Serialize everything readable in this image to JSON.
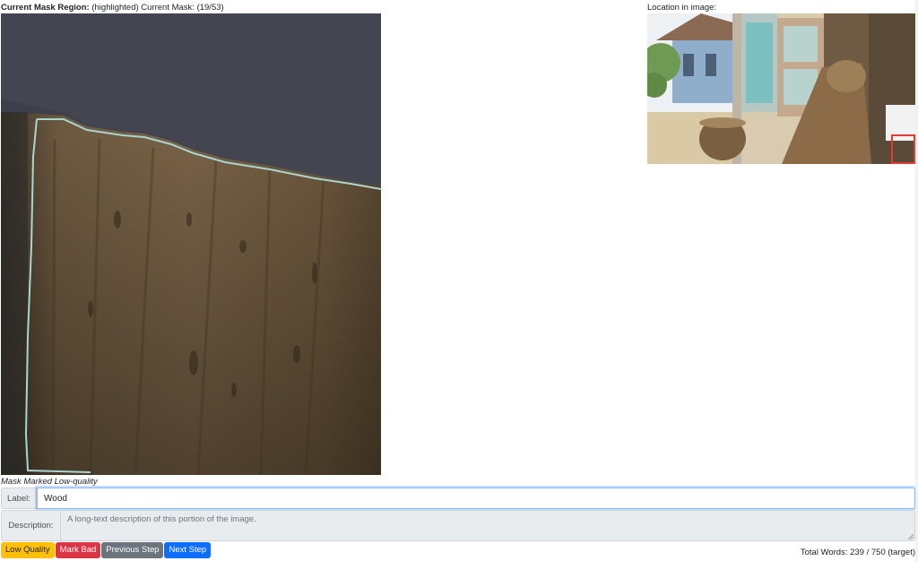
{
  "header": {
    "region_label": "Current Mask Region:",
    "region_suffix": "(highlighted) Current Mask: (19/53)"
  },
  "location": {
    "title": "Location in image:"
  },
  "status": {
    "text": "Mask Marked Low-quality"
  },
  "form": {
    "label_addon": "Label:",
    "label_value": "Wood",
    "description_addon": "Description:",
    "description_placeholder": "A long-text description of this portion of the image."
  },
  "buttons": {
    "low_quality": "Low Quality",
    "mark_bad": "Mark Bad",
    "previous_step": "Previous Step",
    "next_step": "Next Step"
  },
  "footer": {
    "total_words": "Total Words: 239 / 750 (target)"
  },
  "colors": {
    "low_quality": "#ffc107",
    "mark_bad": "#dc3545",
    "previous_step": "#6c757d",
    "next_step": "#0d6efd",
    "mask_outline": "#a9d6d0",
    "location_box": "#e53935"
  }
}
